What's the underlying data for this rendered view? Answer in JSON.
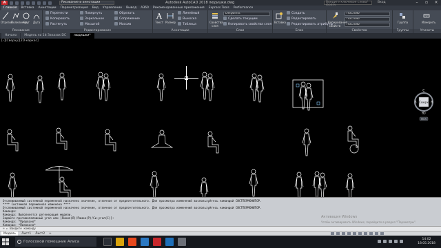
{
  "app": {
    "logo_letter": "A",
    "workspace": "Рисование и аннотации",
    "title": "Autodesk AutoCAD 2018  людишки.dwg",
    "search_placeholder": "Введите ключевое слово/фразу",
    "signin": "Вход"
  },
  "ribbon_tabs": [
    "Главная",
    "Вставка",
    "Аннотации",
    "Параметризация",
    "Вид",
    "Управление",
    "Вывод",
    "A360",
    "Рекомендованные приложения",
    "Express Tools",
    "Performance"
  ],
  "ribbon": {
    "draw": {
      "label": "Рисование",
      "buttons": [
        "Отрезок",
        "Полилиния",
        "Круг",
        "Дуга"
      ]
    },
    "modify": {
      "label": "Редактирование",
      "rows": [
        [
          "Перенести",
          "Повернуть",
          "Обрезать"
        ],
        [
          "Копировать",
          "Зеркальное",
          "Сопряжение"
        ],
        [
          "Растянуть",
          "Масштаб",
          "Массив"
        ]
      ]
    },
    "annotation": {
      "label": "Аннотации",
      "buttons": [
        "Текст",
        "Размер"
      ],
      "rows": [
        "Линейный",
        "Выноска",
        "Таблица"
      ]
    },
    "layers": {
      "label": "Слои",
      "big_label": "Свойства слоя",
      "layer_combo": "Defpoints",
      "rows": [
        "Сделать текущим",
        "Копировать свойства слоя"
      ]
    },
    "block": {
      "label": "Блок",
      "big_label": "Вставка",
      "rows": [
        "Создать",
        "Редактировать",
        "Редактировать атрибуты"
      ]
    },
    "properties": {
      "label": "Свойства",
      "big_label": "Копирование свойств",
      "combos": [
        "ПоСлою",
        "ПоСлою",
        "ПоСлою"
      ]
    },
    "groups": {
      "label": "Группы",
      "big_label": "Группа"
    },
    "utilities": {
      "label": "Утилиты",
      "big_label": "Измерить"
    }
  },
  "file_tabs": [
    "Начало",
    "Модель на 1й Заказах DC",
    "людишки*"
  ],
  "viewport": {
    "label": "[–][Сверху][2D-каркас]",
    "navcube": {
      "north": "С",
      "south": "Ю",
      "west": "З",
      "east": "В",
      "top": "Сверх",
      "wcs": "МСК"
    }
  },
  "command_history": [
    "Отслеживаемый системной переменной назначено значение, отличное от предпочтительного. Для просмотра изменений воспользуйтесь командой СИСТПЕРМОНИТОР.",
    "**** Системная переменная изменена ****",
    "Отслеживаемый системной переменной назначено значение, отличное от предпочтительного. Для просмотра изменений воспользуйтесь командой СИСТПЕРМОНИТОР.",
    "Команда:",
    "Команда: Выполняется регенерация модели.",
    "Задайте противоположный угол или [Линия(Л)/Рамка(Р)/Си-угол(С)]:",
    "Команда: *Прервано*",
    "Команда: *Прервано*"
  ],
  "command_prompt": "⌨ ▸  Введите команду",
  "activation": {
    "title": "Активация Windows",
    "subtitle": "Чтобы активировать Windows, перейдите в раздел \"Параметры\"."
  },
  "layout_tabs": [
    "Модель",
    "Лист1",
    "Лист2",
    "+"
  ],
  "taskbar": {
    "search": "Голосовой помощник Алиса",
    "time": "14:02",
    "date": "18.05.2018"
  },
  "colors": {
    "accent": "#c8282c",
    "ribbon_bg": "#454b55",
    "figures": "#ffffff",
    "command_bg": "#c9ccd1"
  }
}
